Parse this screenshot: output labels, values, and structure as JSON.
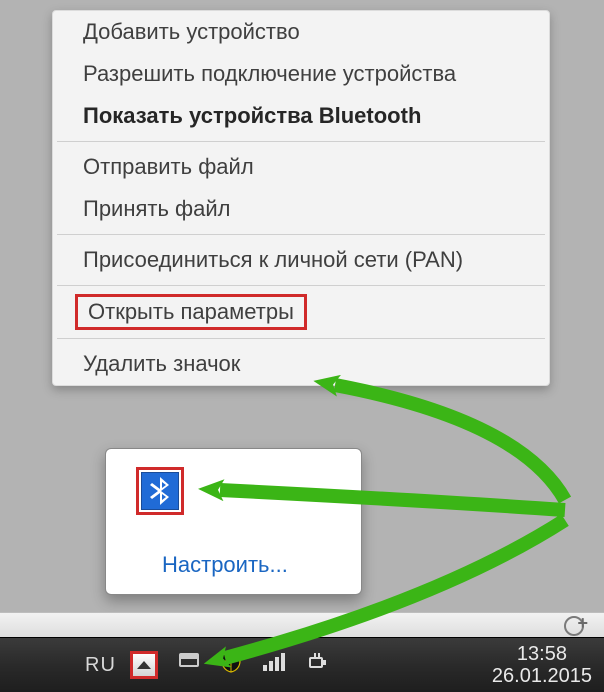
{
  "menu": {
    "add_device": "Добавить устройство",
    "allow_connection": "Разрешить подключение устройства",
    "show_bluetooth_devices": "Показать устройства Bluetooth",
    "send_file": "Отправить файл",
    "receive_file": "Принять файл",
    "join_pan": "Присоединиться к личной сети (PAN)",
    "open_settings": "Открыть параметры",
    "remove_icon": "Удалить значок"
  },
  "tray_popup": {
    "customize": "Настроить..."
  },
  "taskbar": {
    "language": "RU",
    "time": "13:58",
    "date": "26.01.2015"
  },
  "icons": {
    "bluetooth": "bluetooth-icon",
    "overflow_up": "overflow-toggle-icon",
    "action_center": "action-center-icon",
    "shield": "shield-icon",
    "network_bars": "network-icon",
    "power": "power-icon"
  },
  "colors": {
    "highlight_border": "#d02a2a",
    "arrow": "#3bb516"
  }
}
